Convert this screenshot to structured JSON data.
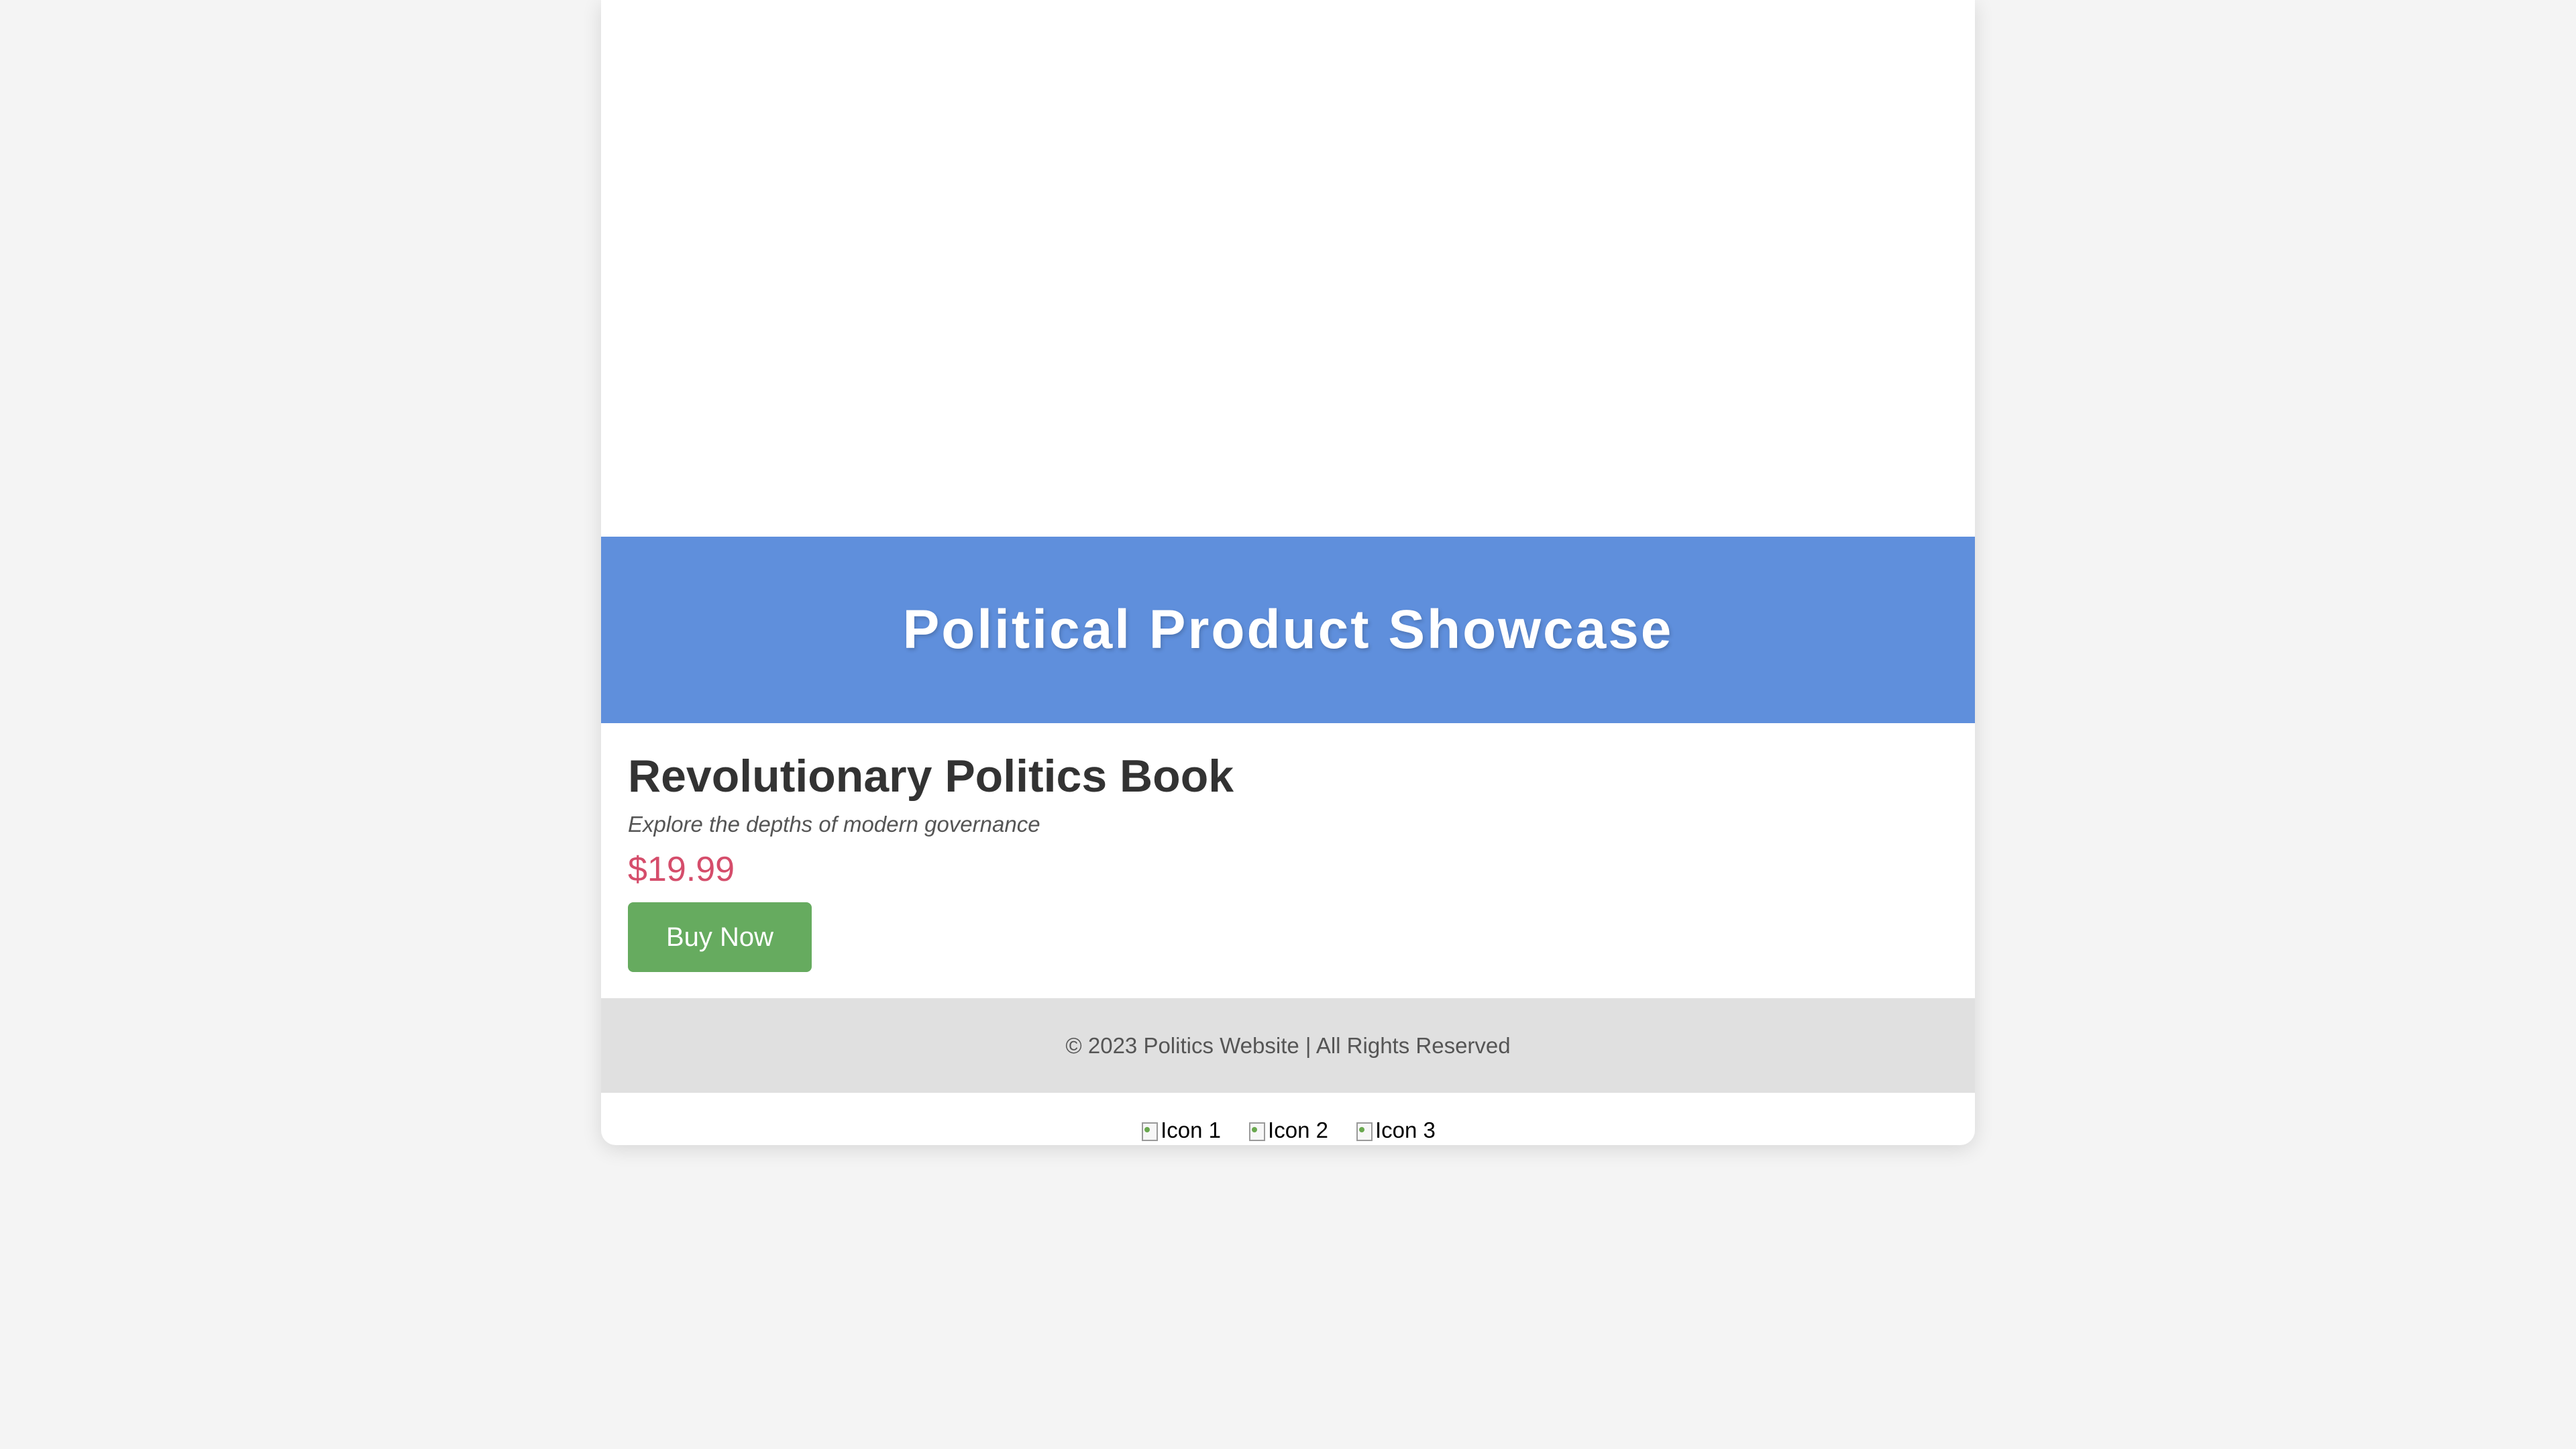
{
  "banner": {
    "title": "Political Product Showcase"
  },
  "product": {
    "name": "Revolutionary Politics Book",
    "tagline": "Explore the depths of modern governance",
    "price": "$19.99",
    "buy_label": "Buy Now"
  },
  "footer": {
    "text": "© 2023 Politics Website | All Rights Reserved"
  },
  "icons": [
    {
      "alt": "Icon 1",
      "icon": "broken-image-icon"
    },
    {
      "alt": "Icon 2",
      "icon": "broken-image-icon"
    },
    {
      "alt": "Icon 3",
      "icon": "broken-image-icon"
    }
  ],
  "colors": {
    "background": "#f4f4f4",
    "banner": "#5f8fdc",
    "price": "#d54d6b",
    "buy_button": "#66ab5f",
    "footer": "#e0e0e0"
  }
}
